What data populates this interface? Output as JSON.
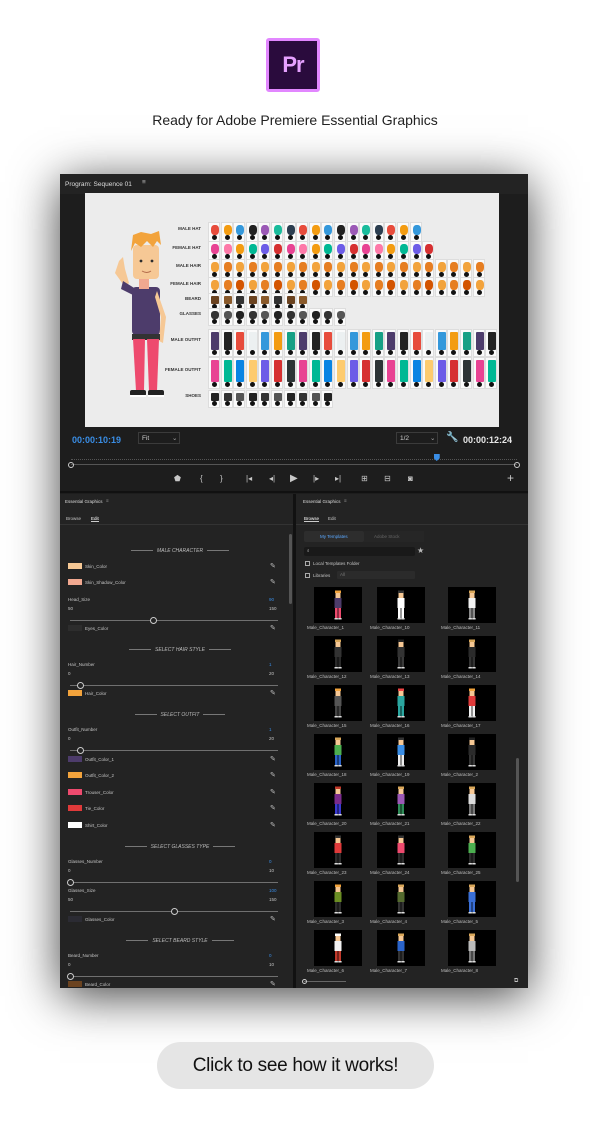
{
  "logo": {
    "text": "Pr"
  },
  "tagline": "Ready for Adobe Premiere Essential Graphics",
  "program_monitor": {
    "title": "Program: Sequence 01",
    "rows": [
      "MALE HAT",
      "FEMALE HAT",
      "MALE HAIR",
      "FEMALE HAIR",
      "BEARD",
      "GLASSES",
      "MALE OUTFIT",
      "FEMALE OUTFIT",
      "SHOES"
    ],
    "timecode_current": "00:00:10:19",
    "zoom": "Fit",
    "resolution": "1/2",
    "timecode_total": "00:00:12:24",
    "playhead_fraction": 0.82
  },
  "eg_left": {
    "title": "Essential Graphics",
    "tabs": {
      "browse": "Browse",
      "edit": "Edit"
    },
    "sections": {
      "male_character": "MALE CHARACTER",
      "hair": "SELECT HAIR STYLE",
      "outfit": "SELECT OUTFIT",
      "glasses": "SELECT GLASSES TYPE",
      "beard": "SELECT BEARD STYLE"
    },
    "colors": {
      "skin": {
        "label": "Skin_Color",
        "color": "#f6c895"
      },
      "skin_shadow": {
        "label": "Skin_Shadow_Color",
        "color": "#f1a890"
      },
      "eyes": {
        "label": "Eyes_Color",
        "color": "#2d2d2d"
      },
      "hair": {
        "label": "Hair_Color",
        "color": "#f2a33c"
      },
      "outfit1": {
        "label": "Outfit_Color_1",
        "color": "#4d3c6b"
      },
      "outfit2": {
        "label": "Outfit_Color_2",
        "color": "#f2a33c"
      },
      "trouser": {
        "label": "Trouser_Color",
        "color": "#ee4a6e"
      },
      "tie": {
        "label": "Tie_Color",
        "color": "#e03a3a"
      },
      "shirt": {
        "label": "Shirt_Color",
        "color": "#ffffff"
      },
      "glasses": {
        "label": "Glasses_Color",
        "color": "#2b2b33"
      },
      "beard": {
        "label": "Beard_Color",
        "color": "#6b4320"
      }
    },
    "sliders": {
      "head_size": {
        "label": "Head_Size",
        "value": "90",
        "min": "50",
        "max": "150",
        "fraction": 0.4
      },
      "hair_number": {
        "label": "Hair_Number",
        "value": "1",
        "min": "0",
        "max": "20",
        "fraction": 0.05
      },
      "outfit_number": {
        "label": "Outfit_Number",
        "value": "1",
        "min": "0",
        "max": "20",
        "fraction": 0.05
      },
      "glasses_number": {
        "label": "Glasses_Number",
        "value": "0",
        "min": "0",
        "max": "10",
        "fraction": 0
      },
      "glasses_size": {
        "label": "Glasses_Size",
        "value": "100",
        "min": "50",
        "max": "150",
        "fraction": 0.5
      },
      "beard_number": {
        "label": "Beard_Number",
        "value": "0",
        "min": "0",
        "max": "10",
        "fraction": 0
      }
    }
  },
  "eg_right": {
    "title": "Essential Graphics",
    "tabs": {
      "browse": "Browse",
      "edit": "Edit"
    },
    "sub_tabs": {
      "my_templates": "My Templates",
      "adobe_stock": "Adobe Stock"
    },
    "local_templates": "Local Templates Folder",
    "libraries": "Libraries",
    "libraries_value": "All",
    "templates": [
      {
        "name": "Male_Character_1",
        "shirt": "#4d3c6b",
        "pants": "#ee4a6e",
        "hair": "#f2a33c"
      },
      {
        "name": "Male_Character_10",
        "shirt": "#ffffff",
        "pants": "#ffffff",
        "hair": "#333333"
      },
      {
        "name": "Male_Character_11",
        "shirt": "#f2f2f2",
        "pants": "#888888",
        "hair": "#d9a75a"
      },
      {
        "name": "Male_Character_12",
        "shirt": "#333333",
        "pants": "#2a2a2a",
        "hair": "#d9a75a"
      },
      {
        "name": "Male_Character_13",
        "shirt": "#333333",
        "pants": "#3a3a3a",
        "hair": "#222222"
      },
      {
        "name": "Male_Character_14",
        "shirt": "#2b2b2b",
        "pants": "#333333",
        "hair": "#d9a75a"
      },
      {
        "name": "Male_Character_15",
        "shirt": "#555555",
        "pants": "#444444",
        "hair": "#f2a33c"
      },
      {
        "name": "Male_Character_16",
        "shirt": "#2aa6a0",
        "pants": "#2aa6a0",
        "hair": "#e44"
      },
      {
        "name": "Male_Character_17",
        "shirt": "#e03a3a",
        "pants": "#f2f2f2",
        "hair": "#f2a33c"
      },
      {
        "name": "Male_Character_18",
        "shirt": "#4caf50",
        "pants": "#2a63c9",
        "hair": "#d9a75a"
      },
      {
        "name": "Male_Character_19",
        "shirt": "#3a8ee6",
        "pants": "#eeeeee",
        "hair": "#333333"
      },
      {
        "name": "Male_Character_2",
        "shirt": "#2b2b2b",
        "pants": "#333333",
        "hair": "#222222"
      },
      {
        "name": "Male_Character_20",
        "shirt": "#7a2b8b",
        "pants": "#3a3ad0",
        "hair": "#c0392b"
      },
      {
        "name": "Male_Character_21",
        "shirt": "#9b59b6",
        "pants": "#2e8b57",
        "hair": "#d9a75a"
      },
      {
        "name": "Male_Character_22",
        "shirt": "#dddddd",
        "pants": "#777777",
        "hair": "#d9a75a"
      },
      {
        "name": "Male_Character_23",
        "shirt": "#e03a3a",
        "pants": "#2b2b2b",
        "hair": "#333333"
      },
      {
        "name": "Male_Character_24",
        "shirt": "#ee4a6e",
        "pants": "#2b2b2b",
        "hair": "#333333"
      },
      {
        "name": "Male_Character_25",
        "shirt": "#4caf50",
        "pants": "#2b2b2b",
        "hair": "#d9a75a"
      },
      {
        "name": "Male_Character_3",
        "shirt": "#6b8e23",
        "pants": "#2b2b2b",
        "hair": "#f2a33c"
      },
      {
        "name": "Male_Character_4",
        "shirt": "#556b2f",
        "pants": "#333333",
        "hair": "#d9a75a"
      },
      {
        "name": "Male_Character_5",
        "shirt": "#3a6fd6",
        "pants": "#3a6fd6",
        "hair": "#d9a75a"
      },
      {
        "name": "Male_Character_6",
        "shirt": "#f2f2f2",
        "pants": "#c0392b",
        "hair": "#ffffff"
      },
      {
        "name": "Male_Character_7",
        "shirt": "#2a63c9",
        "pants": "#333333",
        "hair": "#d9a75a"
      },
      {
        "name": "Male_Character_8",
        "shirt": "#bbbbbb",
        "pants": "#777777",
        "hair": "#d9a75a"
      }
    ]
  },
  "cta": "Click to see how it works!"
}
